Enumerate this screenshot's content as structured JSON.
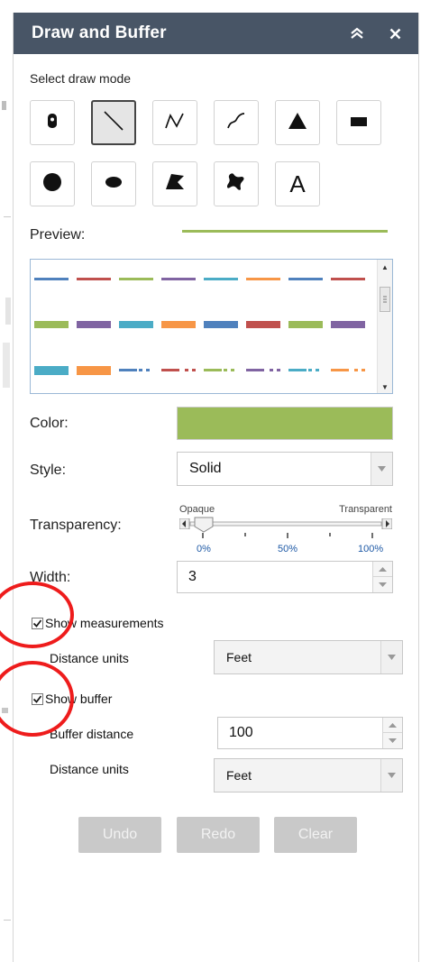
{
  "panel": {
    "title": "Draw and Buffer",
    "collapse_icon": "double-chevron-up-icon",
    "close_icon": "close-icon"
  },
  "draw_mode": {
    "label": "Select draw mode",
    "selected": "line",
    "tools": [
      {
        "name": "point",
        "icon": "point-pin-icon"
      },
      {
        "name": "line",
        "icon": "line-icon"
      },
      {
        "name": "polyline",
        "icon": "polyline-icon"
      },
      {
        "name": "freehand-polyline",
        "icon": "freehand-line-icon"
      },
      {
        "name": "triangle",
        "icon": "triangle-icon"
      },
      {
        "name": "rectangle",
        "icon": "rectangle-icon"
      },
      {
        "name": "circle",
        "icon": "circle-icon"
      },
      {
        "name": "ellipse",
        "icon": "ellipse-icon"
      },
      {
        "name": "polygon",
        "icon": "polygon-icon"
      },
      {
        "name": "freehand-polygon",
        "icon": "freehand-polygon-icon"
      },
      {
        "name": "text",
        "icon": "text-icon",
        "glyph": "A"
      }
    ]
  },
  "preview": {
    "label": "Preview:",
    "line_color": "#9bbb59"
  },
  "palette": {
    "colors": [
      "#4f81bd",
      "#c0504d",
      "#9bbb59",
      "#8064a2",
      "#4bacc6",
      "#f79646"
    ]
  },
  "color": {
    "label": "Color:",
    "value": "#9bbb59"
  },
  "style": {
    "label": "Style:",
    "value": "Solid"
  },
  "transparency": {
    "label": "Transparency:",
    "left_label": "Opaque",
    "right_label": "Transparent",
    "ticks": [
      "0%",
      "50%",
      "100%"
    ],
    "value_percent": 0
  },
  "width": {
    "label": "Width:",
    "value": "3"
  },
  "measurements": {
    "label": "Show measurements",
    "checked": true,
    "units_label": "Distance units",
    "units_value": "Feet"
  },
  "buffer": {
    "label": "Show buffer",
    "checked": true,
    "distance_label": "Buffer distance",
    "distance_value": "100",
    "units_label": "Distance units",
    "units_value": "Feet"
  },
  "actions": {
    "undo": "Undo",
    "redo": "Redo",
    "clear": "Clear"
  },
  "annotation_color": "#ee1c1c"
}
